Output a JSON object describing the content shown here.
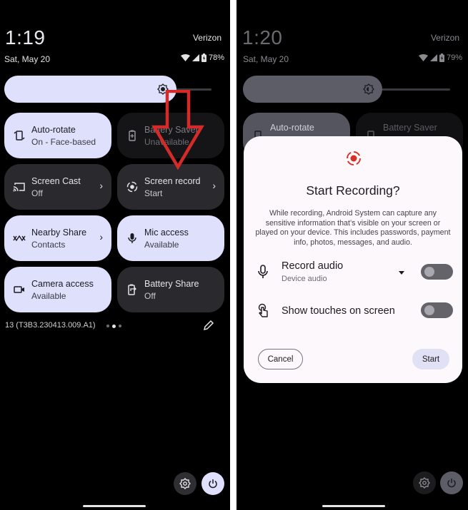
{
  "left_screen": {
    "clock": "1:19",
    "carrier": "Verizon",
    "date": "Sat, May 20",
    "battery": "78%",
    "brightness_level": 0.83,
    "tiles": [
      {
        "label": "Auto-rotate",
        "sub": "On - Face-based",
        "state": "on",
        "icon": "rotate-icon",
        "chevron": false
      },
      {
        "label": "Battery Saver",
        "sub": "Unavailable",
        "state": "dim",
        "icon": "battery-icon",
        "chevron": false
      },
      {
        "label": "Screen Cast",
        "sub": "Off",
        "state": "off",
        "icon": "cast-icon",
        "chevron": true
      },
      {
        "label": "Screen record",
        "sub": "Start",
        "state": "off",
        "icon": "screen-record-icon",
        "chevron": true
      },
      {
        "label": "Nearby Share",
        "sub": "Contacts",
        "state": "on",
        "icon": "nearby-share-icon",
        "chevron": true
      },
      {
        "label": "Mic access",
        "sub": "Available",
        "state": "on",
        "icon": "mic-icon",
        "chevron": false
      },
      {
        "label": "Camera access",
        "sub": "Available",
        "state": "on",
        "icon": "camera-icon",
        "chevron": false
      },
      {
        "label": "Battery Share",
        "sub": "Off",
        "state": "off",
        "icon": "battery-share-icon",
        "chevron": false
      }
    ],
    "build": "13 (T3B3.230413.009.A1)",
    "page_dots": {
      "count": 3,
      "active": 1
    },
    "annotation_arrow_color": "#d42a2a"
  },
  "right_screen": {
    "clock": "1:20",
    "carrier": "Verizon",
    "date": "Sat, May 20",
    "battery": "79%",
    "tiles": [
      {
        "label": "Auto-rotate",
        "state": "on"
      },
      {
        "label": "Battery Saver",
        "state": "dim"
      }
    ],
    "dialog": {
      "title": "Start Recording?",
      "body": "While recording, Android System can capture any sensitive information that’s visible on your screen or played on your device. This includes passwords, payment info, photos, messages, and audio.",
      "record_audio_label": "Record audio",
      "record_audio_sub": "Device audio",
      "record_audio_enabled": false,
      "show_touches_label": "Show touches on screen",
      "show_touches_enabled": false,
      "cancel_label": "Cancel",
      "start_label": "Start",
      "accent": "#d93025"
    }
  },
  "colors": {
    "tile_on": "#dfe0fb",
    "tile_off": "#2a2a2e",
    "dialog_bg": "#fdf8fc"
  }
}
